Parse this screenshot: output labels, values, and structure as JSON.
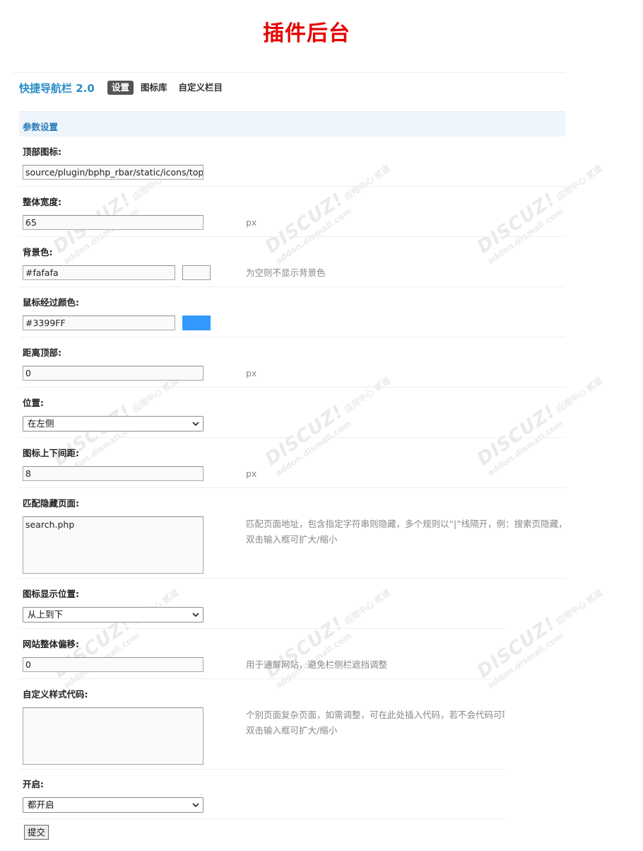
{
  "page_heading": "插件后台",
  "plugin": {
    "title": "快捷导航栏 2.0",
    "tabs": [
      {
        "label": "设置",
        "active": true
      },
      {
        "label": "图标库",
        "active": false
      },
      {
        "label": "自定义栏目",
        "active": false
      }
    ]
  },
  "section_title": "参数设置",
  "fields": {
    "top_icon": {
      "label": "顶部图标:",
      "value": "source/plugin/bphp_rbar/static/icons/top"
    },
    "width": {
      "label": "整体宽度:",
      "value": "65",
      "unit": "px"
    },
    "bg_color": {
      "label": "背景色:",
      "value": "#fafafa",
      "swatch": "#fafafa",
      "hint": "为空则不显示背景色"
    },
    "hover_color": {
      "label": "鼠标经过颜色:",
      "value": "#3399FF",
      "swatch": "#3399FF"
    },
    "top_offset": {
      "label": "距离顶部:",
      "value": "0",
      "unit": "px"
    },
    "position": {
      "label": "位置:",
      "selected": "在左侧"
    },
    "icon_spacing": {
      "label": "图标上下间距:",
      "value": "8",
      "unit": "px"
    },
    "hide_pages": {
      "label": "匹配隐藏页面:",
      "value": "search.php",
      "hint_line1": "匹配页面地址，包含指定字符串则隐藏，多个规则以“|”线隔开，例：搜索页隐藏，贝",
      "hint_line2": "双击输入框可扩大/缩小"
    },
    "icon_direction": {
      "label": "图标显示位置:",
      "selected": "从上到下"
    },
    "site_offset": {
      "label": "网站整体偏移:",
      "value": "0",
      "hint": "用于通屏网站，避免栏侧栏遮挡调整"
    },
    "custom_css": {
      "label": "自定义样式代码:",
      "value": "",
      "hint_line1": "个别页面复杂页面，如需调整，可在此处插入代码，若不会代码可联系",
      "hint_line2": "双击输入框可扩大/缩小"
    },
    "enable": {
      "label": "开启:",
      "selected": "都开启"
    }
  },
  "submit_label": "提交",
  "watermark": {
    "brand": "DISCUZ!",
    "cn": "应用中心",
    "site": "addon.dismall.com",
    "tag": "贰道"
  },
  "icons": {
    "select_arrow": "chevron-down-icon"
  }
}
